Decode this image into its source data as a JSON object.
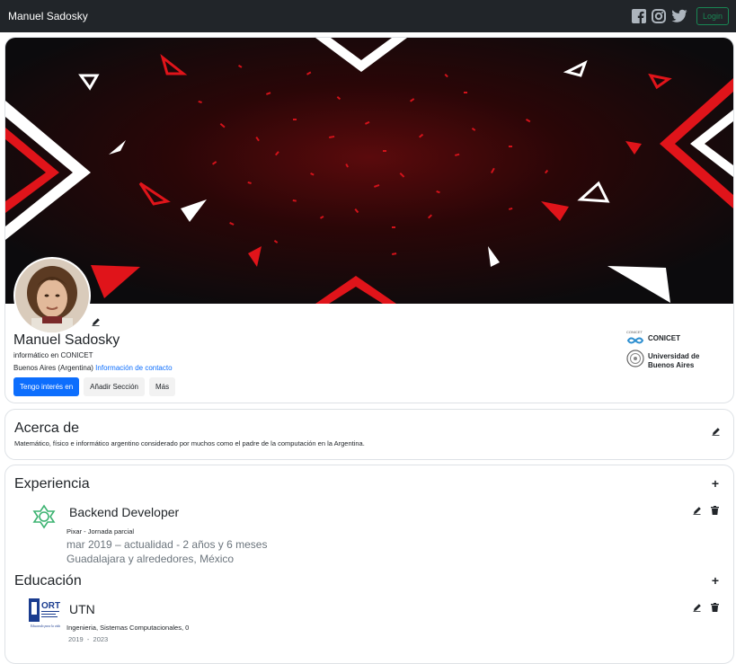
{
  "navbar": {
    "brand": "Manuel Sadosky",
    "icons": [
      "facebook-icon",
      "instagram-icon",
      "twitter-icon"
    ],
    "login_label": "Login"
  },
  "profile": {
    "name": "Manuel Sadosky",
    "headline": "informático en CONICET",
    "location": "Buenos Aires (Argentina)",
    "contact_link": "Información de contacto",
    "buttons": {
      "primary": "Tengo interés en",
      "add_section": "Añadir Sección",
      "more": "Más"
    },
    "orgs": [
      {
        "logo_text": "CONICET",
        "name": "CONICET"
      },
      {
        "name_line1": "Universidad de",
        "name_line2": "Buenos Aires"
      }
    ]
  },
  "about": {
    "title": "Acerca de",
    "text": "Matemático, físico e informático argentino considerado por muchos como el padre de la computación en la Argentina."
  },
  "experience": {
    "title": "Experiencia",
    "items": [
      {
        "title": "Backend Developer",
        "company": "Pixar - Jornada parcial",
        "dates": "mar 2019 – actualidad - 2 años y 6 meses",
        "location": "Guadalajara y alrededores, México"
      }
    ]
  },
  "education": {
    "title": "Educación",
    "items": [
      {
        "logo_text_1": "ORT",
        "logo_text_2": "Educando para la vida",
        "title": "UTN",
        "degree": "Ingenieria, Sistemas Computacionales, 0",
        "start": "2019",
        "sep": "-",
        "end": "2023"
      }
    ]
  },
  "colors": {
    "navbar": "#212529",
    "primary": "#0d6efd",
    "login": "#198754",
    "banner_red": "#e0141a"
  }
}
